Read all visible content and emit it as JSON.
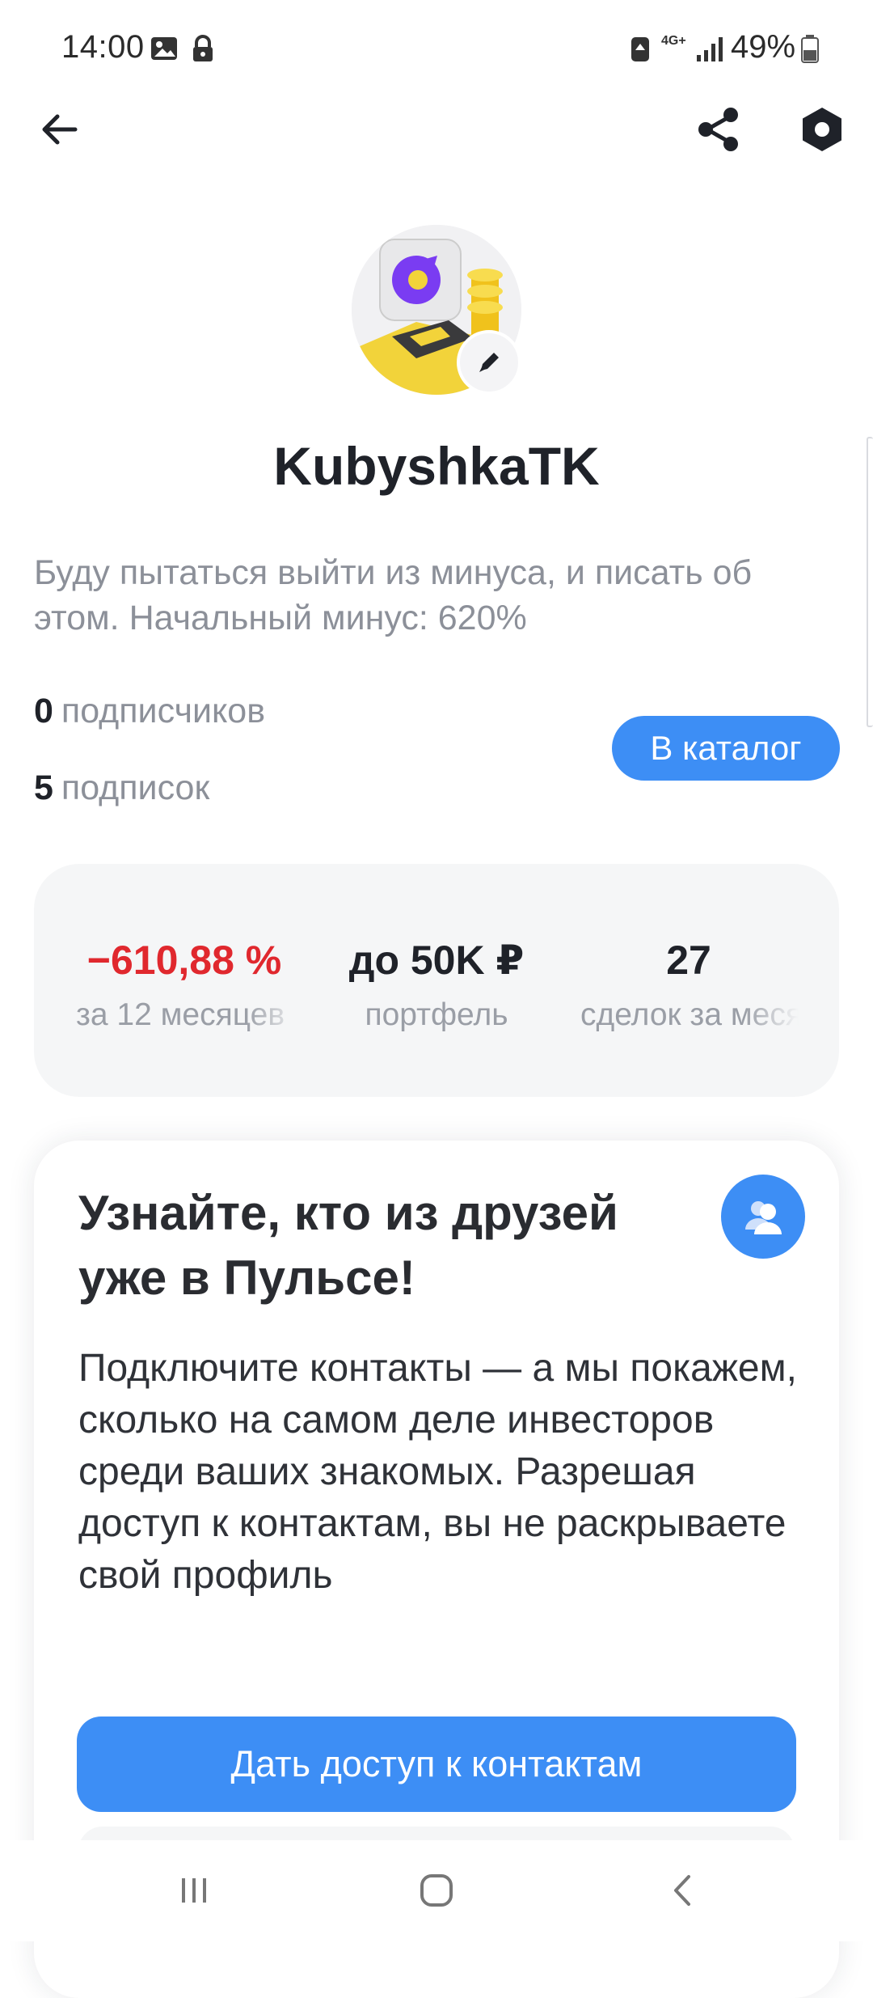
{
  "status_bar": {
    "time": "14:00",
    "battery_percent": "49%",
    "network": "4G+",
    "icons": [
      "gallery-icon",
      "lock-icon",
      "battery-saver-icon",
      "signal-icon",
      "battery-icon"
    ]
  },
  "nav": {
    "back_icon": "arrow-left-icon",
    "share_icon": "share-icon",
    "settings_icon": "hexagon-settings-icon"
  },
  "profile": {
    "username": "KubyshkaTK",
    "bio": "Буду пытаться выйти из минуса, и писать об этом. Начальный минус: 620%",
    "followers_count": "0",
    "followers_label": "подписчиков",
    "following_count": "5",
    "following_label": "подписок",
    "catalog_button": "В каталог"
  },
  "metrics": [
    {
      "value": "−610,88 %",
      "label": "за 12 месяцев",
      "color": "#e0282e"
    },
    {
      "value": "до 50K ₽",
      "label": "портфель",
      "color": "#1f2229"
    },
    {
      "value": "27",
      "label": "сделок за месяц",
      "color": "#1f2229"
    }
  ],
  "invite": {
    "title": "Узнайте, кто из друзей уже в Пульсе!",
    "body": "Подключите контакты — а мы покажем, сколько на самом деле инвесторов среди ваших знакомых. Разрешая доступ к контактам, вы не раскрываете свой профиль",
    "button": "Дать доступ к контактам",
    "icon": "contacts-icon"
  },
  "system_nav": {
    "recents_icon": "recents-icon",
    "home_icon": "home-icon",
    "back_icon": "system-back-icon"
  },
  "colors": {
    "accent": "#3d8ef5",
    "negative": "#e0282e",
    "muted_text": "#8c9099"
  }
}
